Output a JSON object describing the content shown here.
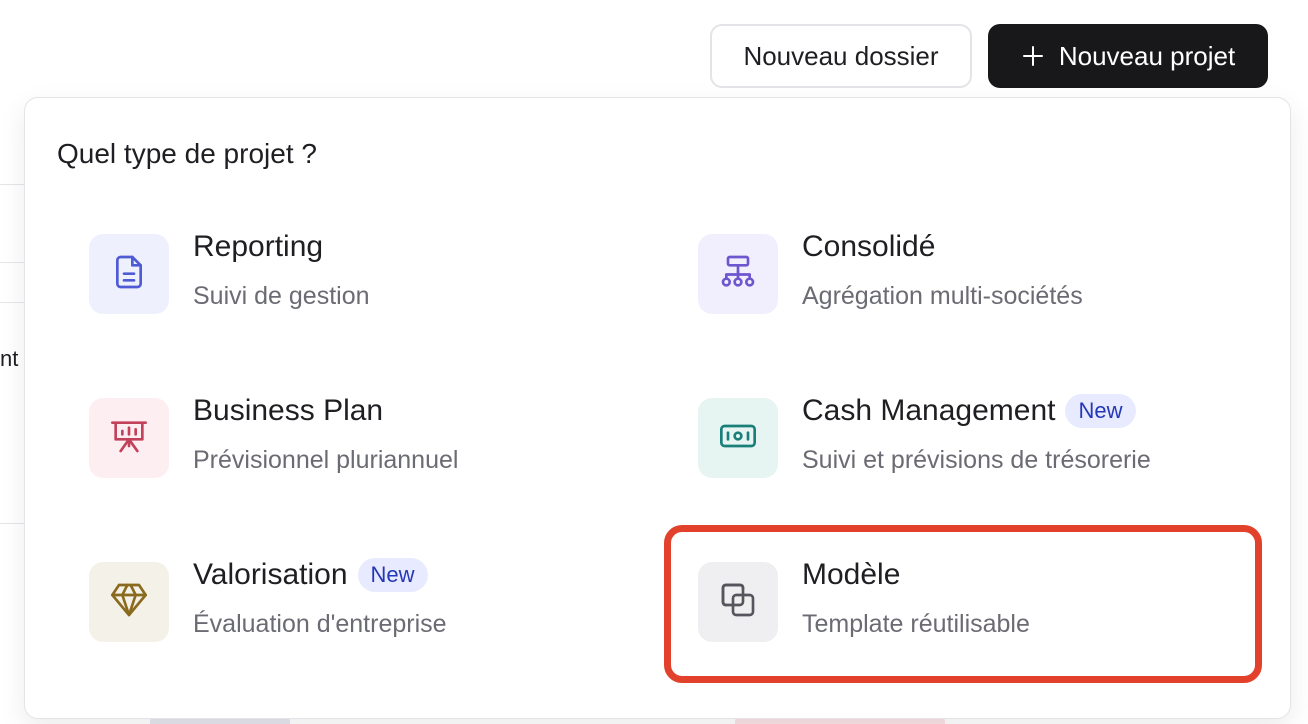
{
  "background": {
    "fragment_text": "nt"
  },
  "header": {
    "new_folder_label": "Nouveau dossier",
    "new_project_label": "Nouveau projet"
  },
  "popover": {
    "title": "Quel type de projet ?",
    "options": [
      {
        "id": "reporting",
        "title": "Reporting",
        "subtitle": "Suivi de gestion",
        "icon": "document-icon",
        "tile_color": "#eef0fd",
        "icon_color": "#4f5bd5"
      },
      {
        "id": "consolide",
        "title": "Consolidé",
        "subtitle": "Agrégation multi-sociétés",
        "icon": "hierarchy-icon",
        "tile_color": "#f1effd",
        "icon_color": "#6e56cf"
      },
      {
        "id": "business-plan",
        "title": "Business Plan",
        "subtitle": "Prévisionnel pluriannuel",
        "icon": "presentation-icon",
        "tile_color": "#fdeef1",
        "icon_color": "#c2415b"
      },
      {
        "id": "cash-management",
        "title": "Cash Management",
        "badge": "New",
        "subtitle": "Suivi et prévisions de trésorerie",
        "icon": "banknote-icon",
        "tile_color": "#e6f4f2",
        "icon_color": "#1b7f79"
      },
      {
        "id": "valorisation",
        "title": "Valorisation",
        "badge": "New",
        "subtitle": "Évaluation d'entreprise",
        "icon": "diamond-icon",
        "tile_color": "#f4f1e8",
        "icon_color": "#8a6a1e"
      },
      {
        "id": "modele",
        "title": "Modèle",
        "subtitle": "Template réutilisable",
        "icon": "copy-icon",
        "tile_color": "#efeff2",
        "icon_color": "#55555d",
        "highlighted": true
      }
    ]
  },
  "colors": {
    "primary_button": "#18181b",
    "badge_bg": "#e8ebff",
    "badge_text": "#2437b8",
    "highlight": "#e2412b"
  }
}
